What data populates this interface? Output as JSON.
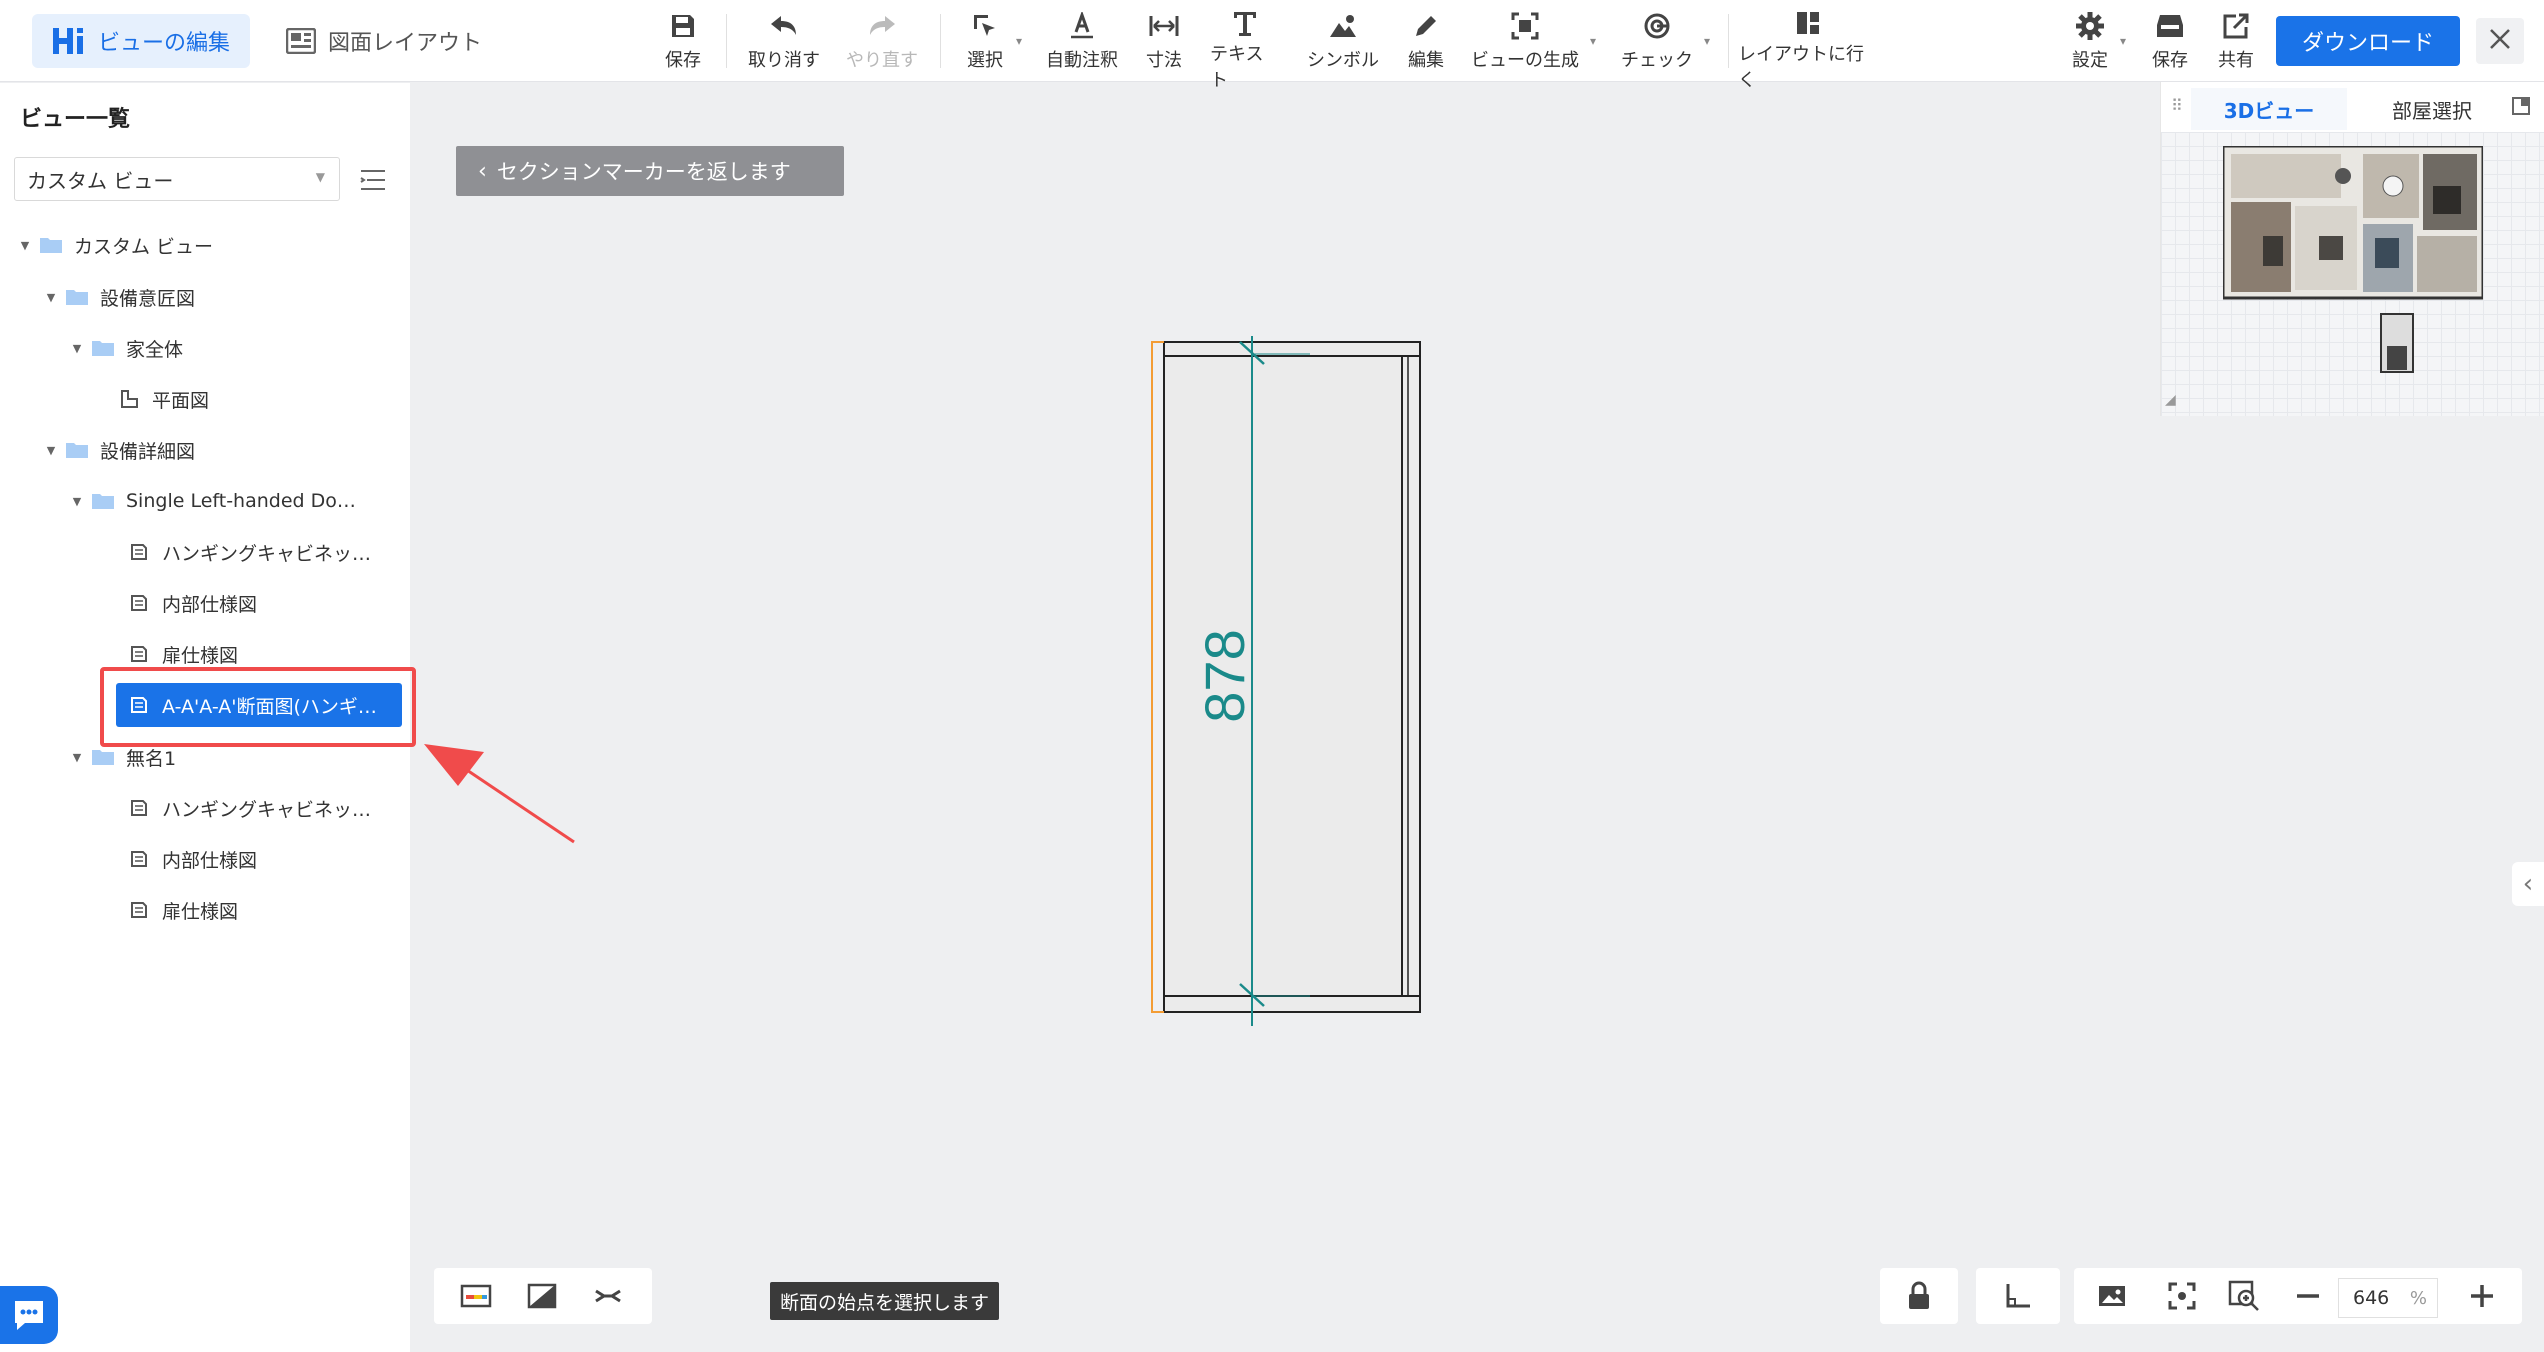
{
  "header": {
    "tabs": [
      {
        "label": "ビューの編集"
      },
      {
        "label": "図面レイアウト"
      }
    ],
    "tools": {
      "save": "保存",
      "undo": "取り消す",
      "redo": "やり直す",
      "select": "選択",
      "auto_annotate": "自動注釈",
      "dimension": "寸法",
      "text": "テキスト",
      "symbol": "シンボル",
      "edit": "編集",
      "generate_view": "ビューの生成",
      "check": "チェック",
      "go_layout": "レイアウトに行く",
      "settings": "設定",
      "save2": "保存",
      "share": "共有"
    },
    "download": "ダウンロード"
  },
  "sidebar": {
    "title": "ビュー一覧",
    "view_select": "カスタム ビュー",
    "tree": [
      {
        "label": "カスタム ビュー"
      },
      {
        "label": "設備意匠図"
      },
      {
        "label": "家全体"
      },
      {
        "label": "平面図"
      },
      {
        "label": "設備詳細図"
      },
      {
        "label": "Single Left-handed Door…"
      },
      {
        "label": "ハンギングキャビネッ…"
      },
      {
        "label": "内部仕様図"
      },
      {
        "label": "扉仕様図"
      },
      {
        "label": "A-A'A-A'断面图(ハンギ…"
      },
      {
        "label": "無名1"
      },
      {
        "label": "ハンギングキャビネッ…"
      },
      {
        "label": "内部仕様図"
      },
      {
        "label": "扉仕様図"
      }
    ]
  },
  "canvas": {
    "back_button": "セクションマーカーを返します",
    "dimension_value": "878"
  },
  "mini_panel": {
    "tab_3d": "3Dビュー",
    "tab_room": "部屋選択"
  },
  "bottom": {
    "tooltip": "断面の始点を選択します",
    "zoom_value": "646",
    "zoom_unit": "%"
  },
  "colors": {
    "accent": "#1a73e8",
    "highlight": "#f04b4b",
    "dimension": "#1a8a8a",
    "edge_orange": "#f39c34"
  }
}
